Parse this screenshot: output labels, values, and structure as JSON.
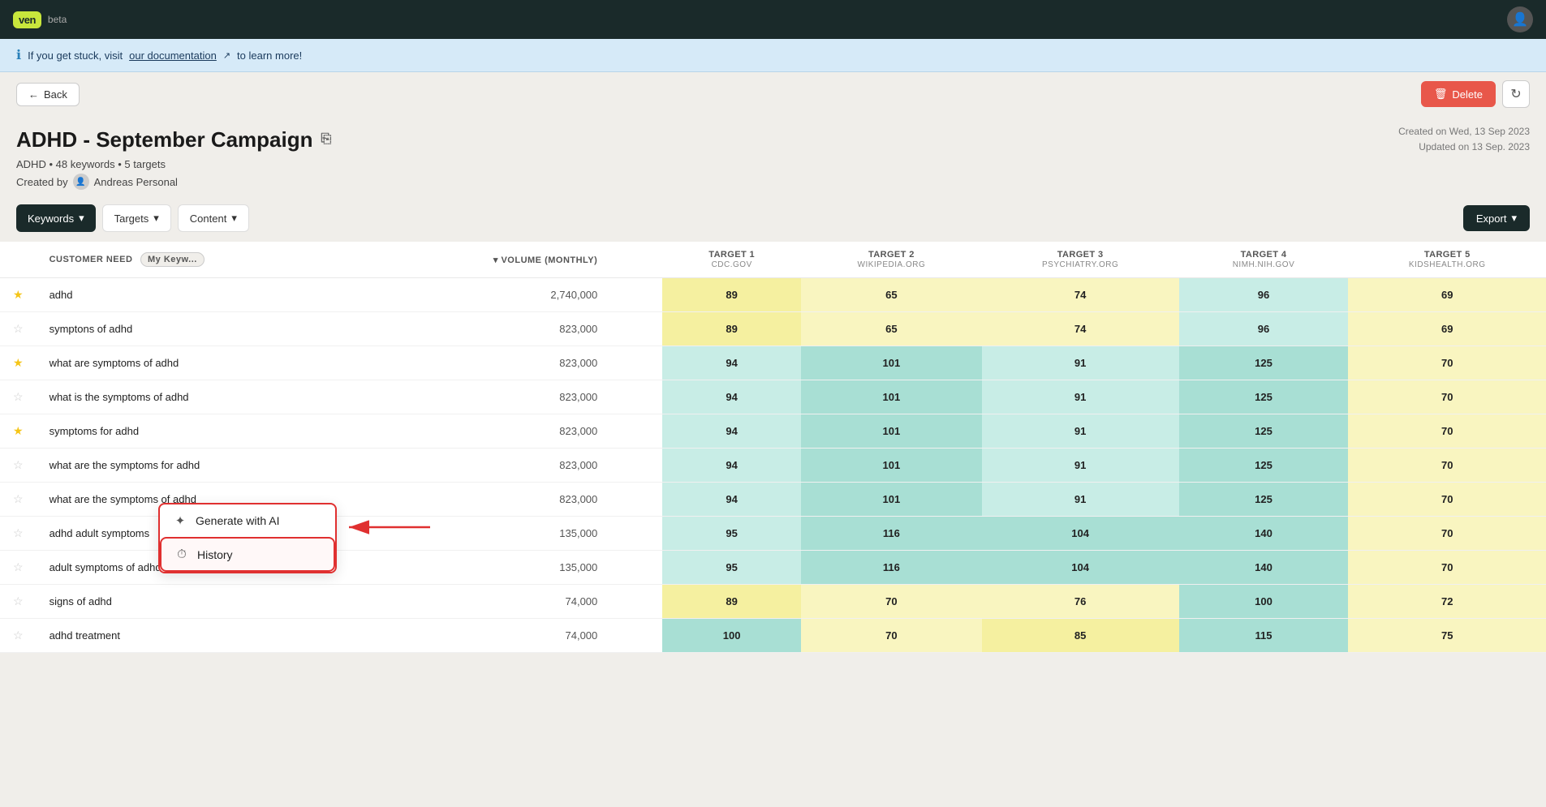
{
  "nav": {
    "logo": "ven",
    "beta": "beta",
    "avatar_symbol": "👤"
  },
  "info_banner": {
    "text_prefix": "If you get stuck, visit ",
    "link_text": "our documentation",
    "text_suffix": " to learn more!"
  },
  "toolbar": {
    "back_label": "Back",
    "delete_label": "Delete",
    "refresh_symbol": "↻"
  },
  "campaign": {
    "title": "ADHD - September Campaign",
    "edit_symbol": "⎘",
    "topic": "ADHD",
    "keyword_count": "48 keywords",
    "target_count": "5 targets",
    "created_by_label": "Created by",
    "creator_name": "Andreas Personal",
    "created_on": "Created on Wed, 13 Sep 2023",
    "updated_on": "Updated on 13 Sep. 2023"
  },
  "tabs": {
    "keywords_label": "Keywords",
    "targets_label": "Targets",
    "content_label": "Content",
    "export_label": "Export"
  },
  "table": {
    "col_customer_need": "CUSTOMER NEED",
    "col_filter_badge": "My Keyw...",
    "col_volume": "VOLUME (MONTHLY)",
    "target1_label": "TARGET 1",
    "target1_domain": "CDC.GOV",
    "target2_label": "TARGET 2",
    "target2_domain": "WIKIPEDIA.ORG",
    "target3_label": "TARGET 3",
    "target3_domain": "PSYCHIATRY.ORG",
    "target4_label": "TARGET 4",
    "target4_domain": "NIMH.NIH.GOV",
    "target5_label": "TARGET 5",
    "target5_domain": "KIDSHEALTH.ORG",
    "rows": [
      {
        "keyword": "adhd",
        "starred": true,
        "volume": "2,740,000",
        "t1": 89,
        "t2": 65,
        "t3": 74,
        "t4": 96,
        "t5": 69
      },
      {
        "keyword": "symptons of adhd",
        "starred": false,
        "volume": "823,000",
        "t1": 89,
        "t2": 65,
        "t3": 74,
        "t4": 96,
        "t5": 69
      },
      {
        "keyword": "what are symptoms of adhd",
        "starred": true,
        "volume": "823,000",
        "t1": 94,
        "t2": 101,
        "t3": 91,
        "t4": 125,
        "t5": 70
      },
      {
        "keyword": "what is the symptoms of adhd",
        "starred": false,
        "volume": "823,000",
        "t1": 94,
        "t2": 101,
        "t3": 91,
        "t4": 125,
        "t5": 70
      },
      {
        "keyword": "symptoms for adhd",
        "starred": true,
        "volume": "823,000",
        "t1": 94,
        "t2": 101,
        "t3": 91,
        "t4": 125,
        "t5": 70
      },
      {
        "keyword": "what are the symptoms for adhd",
        "starred": false,
        "volume": "823,000",
        "t1": 94,
        "t2": 101,
        "t3": 91,
        "t4": 125,
        "t5": 70
      },
      {
        "keyword": "what are the symptoms of adhd",
        "starred": false,
        "volume": "823,000",
        "t1": 94,
        "t2": 101,
        "t3": 91,
        "t4": 125,
        "t5": 70
      },
      {
        "keyword": "adhd adult symptoms",
        "starred": false,
        "volume": "135,000",
        "t1": 95,
        "t2": 116,
        "t3": 104,
        "t4": 140,
        "t5": 70
      },
      {
        "keyword": "adult symptoms of adhd",
        "starred": false,
        "volume": "135,000",
        "t1": 95,
        "t2": 116,
        "t3": 104,
        "t4": 140,
        "t5": 70
      },
      {
        "keyword": "signs of adhd",
        "starred": false,
        "volume": "74,000",
        "t1": 89,
        "t2": 70,
        "t3": 76,
        "t4": 100,
        "t5": 72
      },
      {
        "keyword": "adhd treatment",
        "starred": false,
        "volume": "74,000",
        "t1": 100,
        "t2": 70,
        "t3": 85,
        "t4": 115,
        "t5": 75
      }
    ]
  },
  "dropdown": {
    "generate_label": "Generate with AI",
    "history_label": "History",
    "generate_icon": "✦",
    "history_icon": "⏱"
  },
  "annotation": {
    "arrow": "←"
  }
}
